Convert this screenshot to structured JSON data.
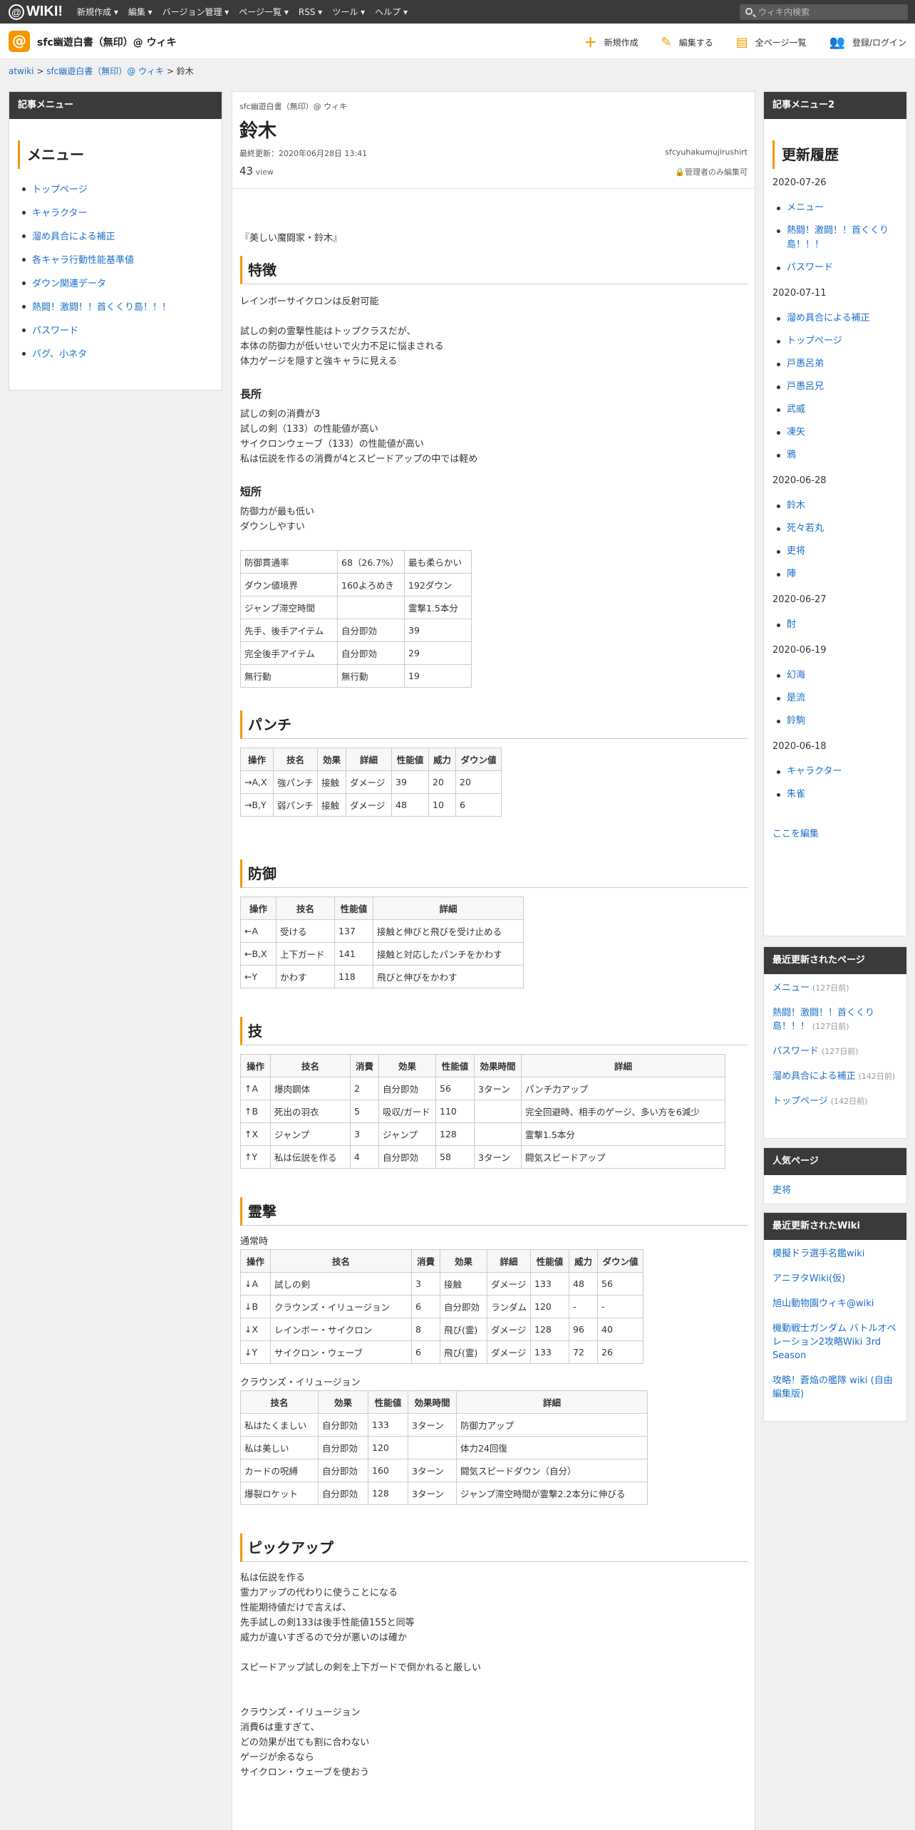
{
  "topbar": {
    "logo": "WIKI!",
    "menus": [
      "新規作成 ▾",
      "編集 ▾",
      "バージョン管理 ▾",
      "ページ一覧 ▾",
      "RSS ▾",
      "ツール ▾",
      "ヘルプ ▾"
    ],
    "search_placeholder": "ウィキ内検索"
  },
  "site": {
    "title": "sfc幽遊白書（無印）@ ウィキ",
    "actions": [
      {
        "icon": "plus-icon",
        "glyph": "＋",
        "label": "新規作成"
      },
      {
        "icon": "pencil-icon",
        "glyph": "✎",
        "label": "編集する"
      },
      {
        "icon": "document-icon",
        "glyph": "▤",
        "label": "全ページ一覧"
      },
      {
        "icon": "user-add-icon",
        "glyph": "👥",
        "label": "登録/ログイン"
      }
    ]
  },
  "breadcrumb": {
    "items": [
      "atwiki",
      "sfc幽遊白書（無印）@ ウィキ"
    ],
    "current": "鈴木",
    "sep": " > "
  },
  "left_menu": {
    "header": "記事メニュー",
    "title": "メニュー",
    "items": [
      "トップページ",
      "キャラクター",
      "溜め具合による補正",
      "各キャラ行動性能基準値",
      "ダウン関連データ",
      "熱闘！激闘！！首くくり島！！！",
      "パスワード",
      "バグ、小ネタ"
    ]
  },
  "page": {
    "site_name": "sfc幽遊白書（無印）@ ウィキ",
    "title": "鈴木",
    "last_updated": "最終更新：2020年06月28日 13:41",
    "author": "sfcyuhakumujirushirt",
    "views": "43",
    "views_label": " view",
    "admin_only": "管理者のみ編集可"
  },
  "content": {
    "quote": "『美しい魔闘家・鈴木』",
    "sec_features": "特徴",
    "features": [
      "レインボーサイクロンは反射可能",
      "",
      "試しの剣の霊撃性能はトップクラスだが、",
      "本体の防御力が低いせいで火力不足に悩まされる",
      "体力ゲージを隠すと強キャラに見える"
    ],
    "sec_pros": "長所",
    "pros": [
      "試しの剣の消費が3",
      "試しの剣（133）の性能値が高い",
      "サイクロンウェーブ（133）の性能値が高い",
      "私は伝説を作るの消費が4とスピードアップの中では軽め"
    ],
    "sec_cons": "短所",
    "cons": [
      "防御力が最も低い",
      "ダウンしやすい"
    ],
    "stats": [
      [
        "防御貫通率",
        "68（26.7%）",
        "最も柔らかい"
      ],
      [
        "ダウン値境界",
        "160よろめき",
        "192ダウン"
      ],
      [
        "ジャンプ滞空時間",
        "",
        "霊撃1.5本分"
      ],
      [
        "先手、後手アイテム",
        "自分即効",
        "39"
      ],
      [
        "完全後手アイテム",
        "自分即効",
        "29"
      ],
      [
        "無行動",
        "無行動",
        "19"
      ]
    ],
    "sec_punch": "パンチ",
    "punch_headers": [
      "操作",
      "技名",
      "効果",
      "詳細",
      "性能値",
      "威力",
      "ダウン値"
    ],
    "punch_rows": [
      [
        "→A,X",
        "強パンチ",
        "接触",
        "ダメージ",
        "39",
        "20",
        "20"
      ],
      [
        "→B,Y",
        "弱パンチ",
        "接触",
        "ダメージ",
        "48",
        "10",
        "6"
      ]
    ],
    "sec_guard": "防御",
    "guard_headers": [
      "操作",
      "技名",
      "性能値",
      "詳細"
    ],
    "guard_rows": [
      [
        "←A",
        "受ける",
        "137",
        "接触と伸びと飛びを受け止める"
      ],
      [
        "←B,X",
        "上下ガード",
        "141",
        "接触と対応したパンチをかわす"
      ],
      [
        "←Y",
        "かわす",
        "118",
        "飛びと伸びをかわす"
      ]
    ],
    "sec_skill": "技",
    "skill_headers": [
      "操作",
      "技名",
      "消費",
      "効果",
      "性能値",
      "効果時間",
      "詳細"
    ],
    "skill_rows": [
      [
        "↑A",
        "爆肉鋼体",
        "2",
        "自分即効",
        "56",
        "3ターン",
        "パンチ力アップ"
      ],
      [
        "↑B",
        "死出の羽衣",
        "5",
        "吸収/ガード",
        "110",
        "",
        "完全回避時、相手のゲージ、多い方を6減少"
      ],
      [
        "↑X",
        "ジャンプ",
        "3",
        "ジャンプ",
        "128",
        "",
        "霊撃1.5本分"
      ],
      [
        "↑Y",
        "私は伝説を作る",
        "4",
        "自分即効",
        "58",
        "3ターン",
        "闘気スピードアップ"
      ]
    ],
    "sec_spirit": "霊撃",
    "spirit_note": "通常時",
    "spirit_headers": [
      "操作",
      "技名",
      "消費",
      "効果",
      "詳細",
      "性能値",
      "威力",
      "ダウン値"
    ],
    "spirit_rows": [
      [
        "↓A",
        "試しの剣",
        "3",
        "接触",
        "ダメージ",
        "133",
        "48",
        "56"
      ],
      [
        "↓B",
        "クラウンズ・イリュージョン",
        "6",
        "自分即効",
        "ランダム",
        "120",
        "-",
        "-"
      ],
      [
        "↓X",
        "レインボー・サイクロン",
        "8",
        "飛び(霊)",
        "ダメージ",
        "128",
        "96",
        "40"
      ],
      [
        "↓Y",
        "サイクロン・ウェーブ",
        "6",
        "飛び(霊)",
        "ダメージ",
        "133",
        "72",
        "26"
      ]
    ],
    "crown_note": "クラウンズ・イリュージョン",
    "crown_headers": [
      "技名",
      "効果",
      "性能値",
      "効果時間",
      "詳細"
    ],
    "crown_rows": [
      [
        "私はたくましい",
        "自分即効",
        "133",
        "3ターン",
        "防御力アップ"
      ],
      [
        "私は美しい",
        "自分即効",
        "120",
        "",
        "体力24回復"
      ],
      [
        "カードの呪縛",
        "自分即効",
        "160",
        "3ターン",
        "闘気スピードダウン（自分）"
      ],
      [
        "爆裂ロケット",
        "自分即効",
        "128",
        "3ターン",
        "ジャンプ滞空時間が霊撃2.2本分に伸びる"
      ]
    ],
    "sec_pickup": "ピックアップ",
    "pickup": [
      "私は伝説を作る",
      "霊力アップの代わりに使うことになる",
      "性能期待値だけで言えば、",
      "先手試しの剣133は後手性能値155と同等",
      "威力が違いすぎるので分が悪いのは確か",
      "",
      "スピードアップ試しの剣を上下ガードで倒かれると厳しい",
      "",
      "",
      "クラウンズ・イリュージョン",
      "消費6は重すぎて、",
      "どの効果が出ても割に合わない",
      "ゲージが余るなら",
      "サイクロン・ウェーブを使おう"
    ]
  },
  "right_menu": {
    "header": "記事メニュー2",
    "title": "更新履歴",
    "groups": [
      {
        "date": "2020-07-26",
        "items": [
          "メニュー",
          "熱闘！激闘！！首くくり島！！！",
          "パスワード"
        ]
      },
      {
        "date": "2020-07-11",
        "items": [
          "溜め具合による補正",
          "トップページ",
          "戸愚呂弟",
          "戸愚呂兄",
          "武威",
          "凍矢",
          "鴉"
        ]
      },
      {
        "date": "2020-06-28",
        "items": [
          "鈴木",
          "死々若丸",
          "吏将",
          "陣"
        ]
      },
      {
        "date": "2020-06-27",
        "items": [
          "酎"
        ]
      },
      {
        "date": "2020-06-19",
        "items": [
          "幻海",
          "是流",
          "鈴駒"
        ]
      },
      {
        "date": "2020-06-18",
        "items": [
          "キャラクター",
          "朱雀"
        ]
      }
    ],
    "edit_link": "ここを編集"
  },
  "recent": {
    "header": "最近更新されたページ",
    "items": [
      {
        "name": "メニュー",
        "ago": "(127日前)"
      },
      {
        "name": "熱闘！激闘！！首くくり島！！！",
        "ago": "(127日前)"
      },
      {
        "name": "パスワード",
        "ago": "(127日前)"
      },
      {
        "name": "溜め具合による補正",
        "ago": "(142日前)"
      },
      {
        "name": "トップページ",
        "ago": "(142日前)"
      }
    ]
  },
  "popular": {
    "header": "人気ページ",
    "items": [
      "吏将"
    ]
  },
  "recent_wiki": {
    "header": "最近更新されたWiki",
    "items": [
      "模擬ドラ選手名鑑wiki",
      "アニヲタWiki(仮)",
      "旭山動物園ウィキ@wiki",
      "機動戦士ガンダム バトルオペレーション2攻略Wiki 3rd Season",
      "攻略！蒼焔の艦隊 wiki (自由編集版)"
    ]
  }
}
